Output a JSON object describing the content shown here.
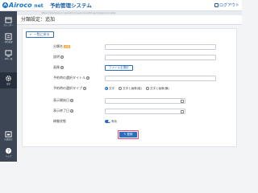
{
  "header": {
    "logo_text": "Airoco",
    "logo_suffix": "net",
    "app_title": "予約管理システム",
    "logout_label": "ログアウト"
  },
  "url_text": "https://example.co.jp/admin/reserve-settings/category/create",
  "sidebar": {
    "items": [
      {
        "label": "カレンダー",
        "icon": "calendar-icon"
      },
      {
        "label": "予約管理",
        "icon": "list-icon"
      },
      {
        "label": "予約一覧",
        "icon": "monitor-icon"
      },
      {
        "label": "設定",
        "icon": "gear-icon",
        "active": true
      },
      {
        "label": "店舗設定",
        "icon": "store-icon"
      },
      {
        "label": "ヘルプ",
        "icon": "help-icon"
      }
    ]
  },
  "page_title": "分類設定：追加",
  "form": {
    "back_label": "← 一覧に戻る",
    "name_label": "分類名",
    "required_badge": "必須",
    "description_label": "説明",
    "image_label": "画像",
    "file_button": "ファイルを選択",
    "select_label": "予約時の選択タイトル",
    "display_type_label": "予約時の選択タイプ",
    "radio_options": [
      "文字",
      "文字と画像(縦)",
      "文字と画像(横)"
    ],
    "start_label": "表示開始日",
    "end_label": "表示終了日",
    "status_label": "稼働状態",
    "status_value": "有効",
    "submit_label": "登録"
  },
  "colors": {
    "accent": "#2a6fbd",
    "sidebar": "#3d4654",
    "highlight": "#e0418b",
    "required": "#f2a53b"
  }
}
